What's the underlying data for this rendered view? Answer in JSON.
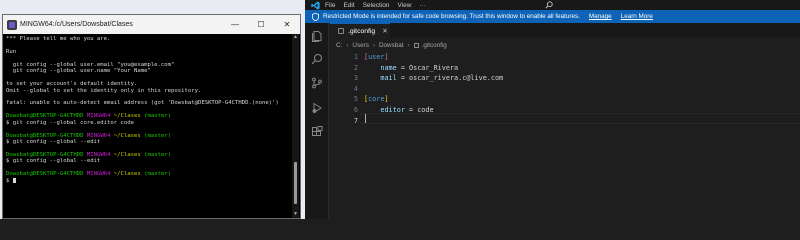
{
  "bash_window": {
    "title": "MINGW64:/c/Users/Dowsbat/Clases",
    "controls": {
      "minimize": "—",
      "maximize": "☐",
      "close": "✕"
    },
    "lines": [
      {
        "text": "*** Please tell me who you are."
      },
      {
        "text": ""
      },
      {
        "text": "Run"
      },
      {
        "text": ""
      },
      {
        "text": "  git config --global user.email \"you@example.com\""
      },
      {
        "text": "  git config --global user.name \"Your Name\""
      },
      {
        "text": ""
      },
      {
        "text": "to set your account's default identity."
      },
      {
        "text": "Omit --global to set the identity only in this repository."
      },
      {
        "text": ""
      },
      {
        "text": "fatal: unable to auto-detect email address (got 'Dowsbat@DESKTOP-G4CTHDD.(none)')"
      },
      {
        "text": ""
      },
      {
        "prompt": {
          "user": "Dowsbat@DESKTOP-G4CTHDD",
          "env": "MINGW64",
          "path": "~/Clases",
          "branch": "(master)"
        }
      },
      {
        "text": "$ git config --global core.editor code"
      },
      {
        "text": ""
      },
      {
        "prompt": {
          "user": "Dowsbat@DESKTOP-G4CTHDD",
          "env": "MINGW64",
          "path": "~/Clases",
          "branch": "(master)"
        }
      },
      {
        "text": "$ git config --global --edit"
      },
      {
        "text": ""
      },
      {
        "prompt": {
          "user": "Dowsbat@DESKTOP-G4CTHDD",
          "env": "MINGW64",
          "path": "~/Clases",
          "branch": "(master)"
        }
      },
      {
        "text": "$ git config --global --edit"
      },
      {
        "text": ""
      },
      {
        "prompt": {
          "user": "Dowsbat@DESKTOP-G4CTHDD",
          "env": "MINGW64",
          "path": "~/Clases",
          "branch": "(master)"
        }
      },
      {
        "text": "$ "
      }
    ]
  },
  "vscode": {
    "menu": [
      "File",
      "Edit",
      "Selection",
      "View",
      "···"
    ],
    "banner": {
      "message": "Restricted Mode is intended for safe code browsing. Trust this window to enable all features.",
      "manage": "Manage",
      "learn_more": "Learn More"
    },
    "tab": {
      "label": ".gitconfig",
      "close": "✕"
    },
    "breadcrumb": [
      "C:",
      "Users",
      "Dowsbat",
      ".gitconfig"
    ],
    "code": [
      {
        "n": "1",
        "tokens": [
          [
            "[",
            "bracket"
          ],
          [
            "user",
            "section"
          ],
          [
            "]",
            "bracket"
          ]
        ]
      },
      {
        "n": "2",
        "tokens": [
          [
            "    name",
            "key"
          ],
          [
            " = ",
            "op"
          ],
          [
            "Oscar_Rivera",
            "val"
          ]
        ]
      },
      {
        "n": "3",
        "tokens": [
          [
            "    mail",
            "key"
          ],
          [
            " = ",
            "op"
          ],
          [
            "oscar_rivera.c@live.com",
            "val"
          ]
        ]
      },
      {
        "n": "4",
        "tokens": []
      },
      {
        "n": "5",
        "tokens": [
          [
            "[",
            "bracket2"
          ],
          [
            "core",
            "section"
          ],
          [
            "]",
            "bracket2"
          ]
        ]
      },
      {
        "n": "6",
        "tokens": [
          [
            "    editor",
            "key"
          ],
          [
            " = ",
            "op"
          ],
          [
            "code",
            "val"
          ]
        ]
      },
      {
        "n": "7",
        "tokens": []
      }
    ],
    "active_line": "7",
    "colors": {
      "banner": "#0e63b7",
      "editor_bg": "#1e1e1e",
      "key": "#9cdcfe",
      "section": "#569cd6",
      "bracket": "#da70d6",
      "bracket2": "#ffd700"
    },
    "activity_icons": [
      "explorer-icon",
      "search-icon",
      "source-control-icon",
      "run-debug-icon",
      "extensions-icon"
    ]
  }
}
